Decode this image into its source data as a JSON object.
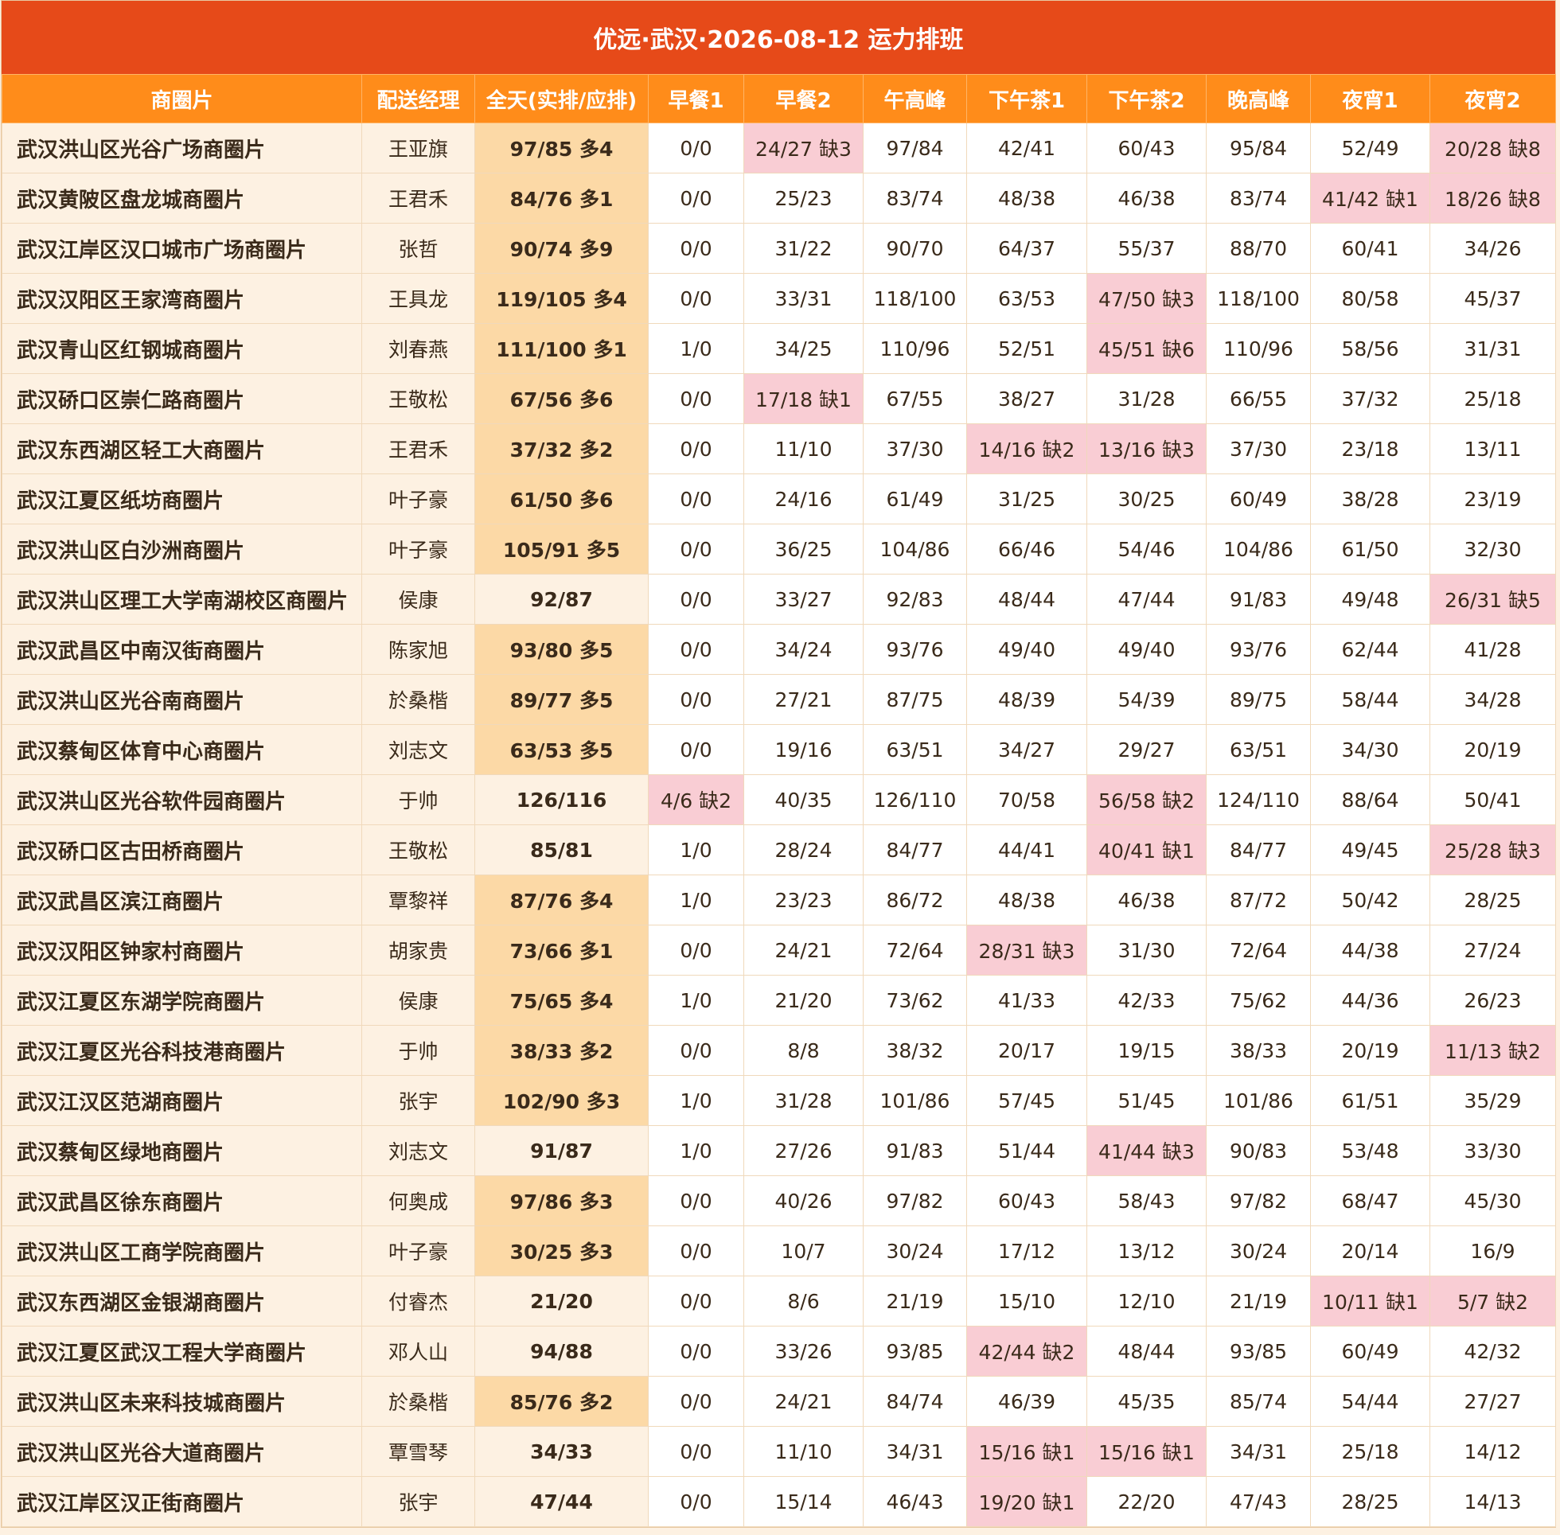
{
  "title": "优远·武汉·2026-08-12 运力排班",
  "columns": [
    "商圈片",
    "配送经理",
    "全天(实排/应排)",
    "早餐1",
    "早餐2",
    "午高峰",
    "下午茶1",
    "下午茶2",
    "晚高峰",
    "夜宵1",
    "夜宵2"
  ],
  "colors": {
    "title_bg": "#e64a19",
    "header_bg": "#ff8c1a",
    "zone_bg": "#fdf1e2",
    "over_bg": "#fcd9a6",
    "short_bg": "#f9cdd4"
  },
  "rows": [
    {
      "zone": "武汉洪山区光谷广场商圈片",
      "manager": "王亚旗",
      "total": "97/85 多4",
      "total_over": true,
      "slots": [
        "0/0",
        "24/27 缺3",
        "97/84",
        "42/41",
        "60/43",
        "95/84",
        "52/49",
        "20/28 缺8"
      ],
      "short": [
        false,
        true,
        false,
        false,
        false,
        false,
        false,
        true
      ]
    },
    {
      "zone": "武汉黄陂区盘龙城商圈片",
      "manager": "王君禾",
      "total": "84/76 多1",
      "total_over": true,
      "slots": [
        "0/0",
        "25/23",
        "83/74",
        "48/38",
        "46/38",
        "83/74",
        "41/42 缺1",
        "18/26 缺8"
      ],
      "short": [
        false,
        false,
        false,
        false,
        false,
        false,
        true,
        true
      ]
    },
    {
      "zone": "武汉江岸区汉口城市广场商圈片",
      "manager": "张哲",
      "total": "90/74 多9",
      "total_over": true,
      "slots": [
        "0/0",
        "31/22",
        "90/70",
        "64/37",
        "55/37",
        "88/70",
        "60/41",
        "34/26"
      ],
      "short": [
        false,
        false,
        false,
        false,
        false,
        false,
        false,
        false
      ]
    },
    {
      "zone": "武汉汉阳区王家湾商圈片",
      "manager": "王具龙",
      "total": "119/105 多4",
      "total_over": true,
      "slots": [
        "0/0",
        "33/31",
        "118/100",
        "63/53",
        "47/50 缺3",
        "118/100",
        "80/58",
        "45/37"
      ],
      "short": [
        false,
        false,
        false,
        false,
        true,
        false,
        false,
        false
      ]
    },
    {
      "zone": "武汉青山区红钢城商圈片",
      "manager": "刘春燕",
      "total": "111/100 多1",
      "total_over": true,
      "slots": [
        "1/0",
        "34/25",
        "110/96",
        "52/51",
        "45/51 缺6",
        "110/96",
        "58/56",
        "31/31"
      ],
      "short": [
        false,
        false,
        false,
        false,
        true,
        false,
        false,
        false
      ]
    },
    {
      "zone": "武汉硚口区崇仁路商圈片",
      "manager": "王敬松",
      "total": "67/56 多6",
      "total_over": true,
      "slots": [
        "0/0",
        "17/18 缺1",
        "67/55",
        "38/27",
        "31/28",
        "66/55",
        "37/32",
        "25/18"
      ],
      "short": [
        false,
        true,
        false,
        false,
        false,
        false,
        false,
        false
      ]
    },
    {
      "zone": "武汉东西湖区轻工大商圈片",
      "manager": "王君禾",
      "total": "37/32 多2",
      "total_over": true,
      "slots": [
        "0/0",
        "11/10",
        "37/30",
        "14/16 缺2",
        "13/16 缺3",
        "37/30",
        "23/18",
        "13/11"
      ],
      "short": [
        false,
        false,
        false,
        true,
        true,
        false,
        false,
        false
      ]
    },
    {
      "zone": "武汉江夏区纸坊商圈片",
      "manager": "叶子豪",
      "total": "61/50 多6",
      "total_over": true,
      "slots": [
        "0/0",
        "24/16",
        "61/49",
        "31/25",
        "30/25",
        "60/49",
        "38/28",
        "23/19"
      ],
      "short": [
        false,
        false,
        false,
        false,
        false,
        false,
        false,
        false
      ]
    },
    {
      "zone": "武汉洪山区白沙洲商圈片",
      "manager": "叶子豪",
      "total": "105/91 多5",
      "total_over": true,
      "slots": [
        "0/0",
        "36/25",
        "104/86",
        "66/46",
        "54/46",
        "104/86",
        "61/50",
        "32/30"
      ],
      "short": [
        false,
        false,
        false,
        false,
        false,
        false,
        false,
        false
      ]
    },
    {
      "zone": "武汉洪山区理工大学南湖校区商圈片",
      "manager": "侯康",
      "total": "92/87",
      "total_over": false,
      "slots": [
        "0/0",
        "33/27",
        "92/83",
        "48/44",
        "47/44",
        "91/83",
        "49/48",
        "26/31 缺5"
      ],
      "short": [
        false,
        false,
        false,
        false,
        false,
        false,
        false,
        true
      ]
    },
    {
      "zone": "武汉武昌区中南汉街商圈片",
      "manager": "陈家旭",
      "total": "93/80 多5",
      "total_over": true,
      "slots": [
        "0/0",
        "34/24",
        "93/76",
        "49/40",
        "49/40",
        "93/76",
        "62/44",
        "41/28"
      ],
      "short": [
        false,
        false,
        false,
        false,
        false,
        false,
        false,
        false
      ]
    },
    {
      "zone": "武汉洪山区光谷南商圈片",
      "manager": "於桑楷",
      "total": "89/77 多5",
      "total_over": true,
      "slots": [
        "0/0",
        "27/21",
        "87/75",
        "48/39",
        "54/39",
        "89/75",
        "58/44",
        "34/28"
      ],
      "short": [
        false,
        false,
        false,
        false,
        false,
        false,
        false,
        false
      ]
    },
    {
      "zone": "武汉蔡甸区体育中心商圈片",
      "manager": "刘志文",
      "total": "63/53 多5",
      "total_over": true,
      "slots": [
        "0/0",
        "19/16",
        "63/51",
        "34/27",
        "29/27",
        "63/51",
        "34/30",
        "20/19"
      ],
      "short": [
        false,
        false,
        false,
        false,
        false,
        false,
        false,
        false
      ]
    },
    {
      "zone": "武汉洪山区光谷软件园商圈片",
      "manager": "于帅",
      "total": "126/116",
      "total_over": false,
      "slots": [
        "4/6 缺2",
        "40/35",
        "126/110",
        "70/58",
        "56/58 缺2",
        "124/110",
        "88/64",
        "50/41"
      ],
      "short": [
        true,
        false,
        false,
        false,
        true,
        false,
        false,
        false
      ]
    },
    {
      "zone": "武汉硚口区古田桥商圈片",
      "manager": "王敬松",
      "total": "85/81",
      "total_over": false,
      "slots": [
        "1/0",
        "28/24",
        "84/77",
        "44/41",
        "40/41 缺1",
        "84/77",
        "49/45",
        "25/28 缺3"
      ],
      "short": [
        false,
        false,
        false,
        false,
        true,
        false,
        false,
        true
      ]
    },
    {
      "zone": "武汉武昌区滨江商圈片",
      "manager": "覃黎祥",
      "total": "87/76 多4",
      "total_over": true,
      "slots": [
        "1/0",
        "23/23",
        "86/72",
        "48/38",
        "46/38",
        "87/72",
        "50/42",
        "28/25"
      ],
      "short": [
        false,
        false,
        false,
        false,
        false,
        false,
        false,
        false
      ]
    },
    {
      "zone": "武汉汉阳区钟家村商圈片",
      "manager": "胡家贵",
      "total": "73/66 多1",
      "total_over": true,
      "slots": [
        "0/0",
        "24/21",
        "72/64",
        "28/31 缺3",
        "31/30",
        "72/64",
        "44/38",
        "27/24"
      ],
      "short": [
        false,
        false,
        false,
        true,
        false,
        false,
        false,
        false
      ]
    },
    {
      "zone": "武汉江夏区东湖学院商圈片",
      "manager": "侯康",
      "total": "75/65 多4",
      "total_over": true,
      "slots": [
        "1/0",
        "21/20",
        "73/62",
        "41/33",
        "42/33",
        "75/62",
        "44/36",
        "26/23"
      ],
      "short": [
        false,
        false,
        false,
        false,
        false,
        false,
        false,
        false
      ]
    },
    {
      "zone": "武汉江夏区光谷科技港商圈片",
      "manager": "于帅",
      "total": "38/33 多2",
      "total_over": true,
      "slots": [
        "0/0",
        "8/8",
        "38/32",
        "20/17",
        "19/15",
        "38/33",
        "20/19",
        "11/13 缺2"
      ],
      "short": [
        false,
        false,
        false,
        false,
        false,
        false,
        false,
        true
      ]
    },
    {
      "zone": "武汉江汉区范湖商圈片",
      "manager": "张宇",
      "total": "102/90 多3",
      "total_over": true,
      "slots": [
        "1/0",
        "31/28",
        "101/86",
        "57/45",
        "51/45",
        "101/86",
        "61/51",
        "35/29"
      ],
      "short": [
        false,
        false,
        false,
        false,
        false,
        false,
        false,
        false
      ]
    },
    {
      "zone": "武汉蔡甸区绿地商圈片",
      "manager": "刘志文",
      "total": "91/87",
      "total_over": false,
      "slots": [
        "1/0",
        "27/26",
        "91/83",
        "51/44",
        "41/44 缺3",
        "90/83",
        "53/48",
        "33/30"
      ],
      "short": [
        false,
        false,
        false,
        false,
        true,
        false,
        false,
        false
      ]
    },
    {
      "zone": "武汉武昌区徐东商圈片",
      "manager": "何奥成",
      "total": "97/86 多3",
      "total_over": true,
      "slots": [
        "0/0",
        "40/26",
        "97/82",
        "60/43",
        "58/43",
        "97/82",
        "68/47",
        "45/30"
      ],
      "short": [
        false,
        false,
        false,
        false,
        false,
        false,
        false,
        false
      ]
    },
    {
      "zone": "武汉洪山区工商学院商圈片",
      "manager": "叶子豪",
      "total": "30/25 多3",
      "total_over": true,
      "slots": [
        "0/0",
        "10/7",
        "30/24",
        "17/12",
        "13/12",
        "30/24",
        "20/14",
        "16/9"
      ],
      "short": [
        false,
        false,
        false,
        false,
        false,
        false,
        false,
        false
      ]
    },
    {
      "zone": "武汉东西湖区金银湖商圈片",
      "manager": "付睿杰",
      "total": "21/20",
      "total_over": false,
      "slots": [
        "0/0",
        "8/6",
        "21/19",
        "15/10",
        "12/10",
        "21/19",
        "10/11 缺1",
        "5/7 缺2"
      ],
      "short": [
        false,
        false,
        false,
        false,
        false,
        false,
        true,
        true
      ]
    },
    {
      "zone": "武汉江夏区武汉工程大学商圈片",
      "manager": "邓人山",
      "total": "94/88",
      "total_over": false,
      "slots": [
        "0/0",
        "33/26",
        "93/85",
        "42/44 缺2",
        "48/44",
        "93/85",
        "60/49",
        "42/32"
      ],
      "short": [
        false,
        false,
        false,
        true,
        false,
        false,
        false,
        false
      ]
    },
    {
      "zone": "武汉洪山区未来科技城商圈片",
      "manager": "於桑楷",
      "total": "85/76 多2",
      "total_over": true,
      "slots": [
        "0/0",
        "24/21",
        "84/74",
        "46/39",
        "45/35",
        "85/74",
        "54/44",
        "27/27"
      ],
      "short": [
        false,
        false,
        false,
        false,
        false,
        false,
        false,
        false
      ]
    },
    {
      "zone": "武汉洪山区光谷大道商圈片",
      "manager": "覃雪琴",
      "total": "34/33",
      "total_over": false,
      "slots": [
        "0/0",
        "11/10",
        "34/31",
        "15/16 缺1",
        "15/16 缺1",
        "34/31",
        "25/18",
        "14/12"
      ],
      "short": [
        false,
        false,
        false,
        true,
        true,
        false,
        false,
        false
      ]
    },
    {
      "zone": "武汉江岸区汉正街商圈片",
      "manager": "张宇",
      "total": "47/44",
      "total_over": false,
      "slots": [
        "0/0",
        "15/14",
        "46/43",
        "19/20 缺1",
        "22/20",
        "47/43",
        "28/25",
        "14/13"
      ],
      "short": [
        false,
        false,
        false,
        true,
        false,
        false,
        false,
        false
      ]
    }
  ]
}
